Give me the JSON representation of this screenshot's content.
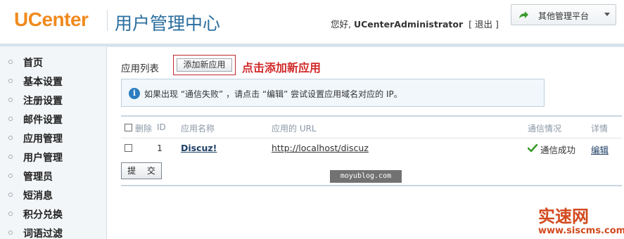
{
  "header": {
    "logo": "UCenter",
    "title": "用户管理中心",
    "greeting": "您好,",
    "username": "UCenterAdministrator",
    "logout_open": "[",
    "logout": "退出",
    "logout_close": "]",
    "platform_menu": "其他管理平台"
  },
  "sidebar": {
    "items": [
      {
        "label": "首页"
      },
      {
        "label": "基本设置"
      },
      {
        "label": "注册设置"
      },
      {
        "label": "邮件设置"
      },
      {
        "label": "应用管理"
      },
      {
        "label": "用户管理"
      },
      {
        "label": "管理员"
      },
      {
        "label": "短消息"
      },
      {
        "label": "积分兑换"
      },
      {
        "label": "词语过滤"
      }
    ]
  },
  "main": {
    "list_title": "应用列表",
    "add_button": "添加新应用",
    "annotation": "点击添加新应用",
    "tip": "如果出现 “通信失败” ，请点击 “编辑” 尝试设置应用域名对应的 IP。",
    "table": {
      "headers": {
        "delete": "删除",
        "id": "ID",
        "name": "应用名称",
        "url": "应用的 URL",
        "status": "通信情况",
        "detail": "详情"
      },
      "rows": [
        {
          "id": "1",
          "name": "Discuz!",
          "url": "http://localhost/discuz",
          "status": "通信成功",
          "detail": "编辑"
        }
      ]
    },
    "submit_button": "提 交"
  },
  "watermarks": {
    "moyublog": "moyublog.com",
    "site_cn": "实速网",
    "site_url": "www.siscms.com"
  },
  "colors": {
    "brand_orange": "#f08a1d",
    "title_blue": "#2a6e9e",
    "annotation_red": "#d22a2a",
    "success_green": "#3a9a2a"
  }
}
